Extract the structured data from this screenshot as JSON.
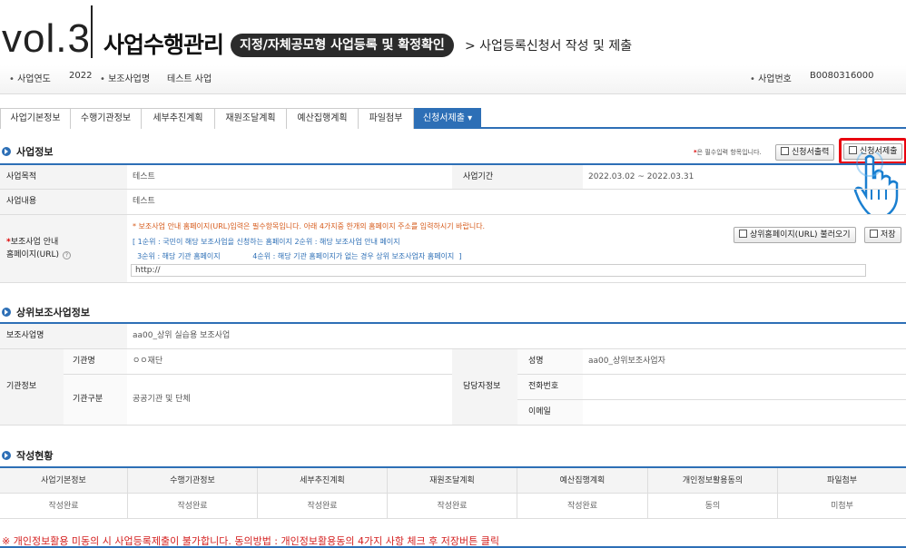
{
  "header": {
    "vol": "vol.3",
    "brand": "사업수행관리",
    "pill": "지정/자체공모형 사업등록 및 확정확인",
    "crumb": "> 사업등록신청서 작성 및 제출"
  },
  "infobar": {
    "year_label": "사업연도",
    "year_value": "2022",
    "project_label": "보조사업명",
    "project_value": "테스트 사업",
    "number_label": "사업번호",
    "number_value": "B0080316000"
  },
  "tabs": [
    "사업기본정보",
    "수행기관정보",
    "세부추진계획",
    "재원조달계획",
    "예산집행계획",
    "파일첨부",
    "신청서제출 ▾"
  ],
  "business_info": {
    "title": "사업정보",
    "required_note_mark": "*",
    "required_note": "은 필수입력 항목입니다.",
    "print_button": "신청서출력",
    "submit_button": "신청서제출",
    "purpose_label": "사업목적",
    "purpose_value": "테스트",
    "period_label": "사업기간",
    "period_value": "2022.03.02 ~ 2022.03.31",
    "content_label": "사업내용",
    "content_value": "테스트",
    "homepage_label_1": "보조사업 안내",
    "homepage_label_2": "홈페이지(URL)",
    "homepage_note_1": "* 보조사업 안내 홈페이지(URL)입력은 필수항목입니다.   아래 4가지중 한개의 홈페이지 주소를 입력하시기 바랍니다.",
    "homepage_note_2": "[ 1순위 : 국민이 해당 보조사업을 신청하는 홈페이지    2순위 : 해당 보조사업 안내 페이지",
    "homepage_note_3": "  3순위 : 해당 기관 홈페이지              4순위 : 해당 기관 홈페이지가 없는 경우 상위 보조사업자 홈페이지  ]",
    "homepage_value": "http://",
    "load_button": "상위홈페이지(URL) 불러오기",
    "save_button": "저장"
  },
  "upper_info": {
    "title": "상위보조사업정보",
    "project_label": "보조사업명",
    "project_value": "aa00_상위 실습용 보조사업",
    "org_label": "기관정보",
    "org_name_label": "기관명",
    "org_name_value": "ㅇㅇ재단",
    "org_type_label": "기관구분",
    "org_type_value": "공공기관 및 단체",
    "manager_label": "담당자정보",
    "name_label": "성명",
    "name_value": "aa00_상위보조사업자",
    "phone_label": "전화번호",
    "phone_value": "",
    "email_label": "이메일",
    "email_value": ""
  },
  "status": {
    "title": "작성현황",
    "headers": [
      "사업기본정보",
      "수행기관정보",
      "세부추진계획",
      "재원조달계획",
      "예산집행계획",
      "개인정보활용동의",
      "파일첨부"
    ],
    "values": [
      "작성완료",
      "작성완료",
      "작성완료",
      "작성완료",
      "작성완료",
      "동의",
      "미첨부"
    ]
  },
  "warning": "※ 개인정보활용 미동의 시 사업등록제출이 불가합니다.   동의방법 : 개인정보활용동의 4가지 사항 체크 후 저장버튼 클릭",
  "colors": {
    "accent": "#2d6fb6",
    "highlight": "#e8000f",
    "warning": "#d41e1e"
  }
}
